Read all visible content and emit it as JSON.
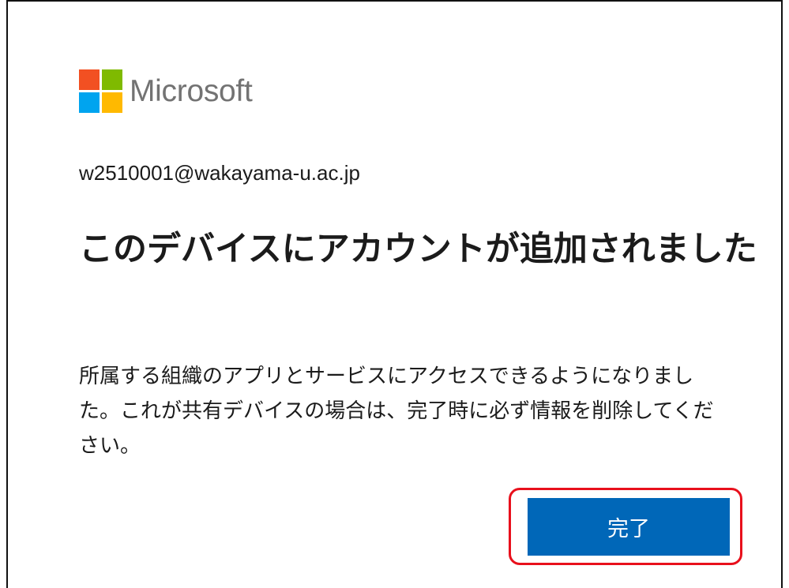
{
  "brand": {
    "name": "Microsoft",
    "logo_colors": [
      "#f25022",
      "#7fba00",
      "#00a4ef",
      "#ffb900"
    ]
  },
  "account": {
    "email": "w2510001@wakayama-u.ac.jp"
  },
  "dialog": {
    "title": "このデバイスにアカウントが追加されました",
    "description": "所属する組織のアプリとサービスにアクセスできるようになりました。これが共有デバイスの場合は、完了時に必ず情報を削除してください。"
  },
  "actions": {
    "done_label": "完了",
    "accent_color": "#0067b8",
    "highlight_color": "#e8101c"
  }
}
